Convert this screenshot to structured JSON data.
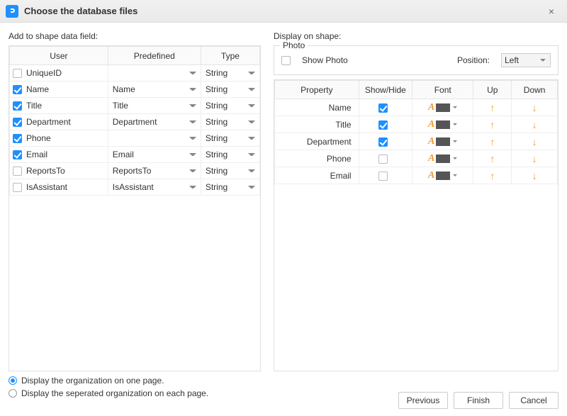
{
  "dialog": {
    "title": "Choose the database files",
    "close_glyph": "×"
  },
  "left": {
    "label": "Add to shape data field:",
    "headers": {
      "user": "User",
      "predefined": "Predefined",
      "type": "Type"
    },
    "rows": [
      {
        "checked": false,
        "user": "UniqueID",
        "predefined": "",
        "type": "String"
      },
      {
        "checked": true,
        "user": "Name",
        "predefined": "Name",
        "type": "String"
      },
      {
        "checked": true,
        "user": "Title",
        "predefined": "Title",
        "type": "String"
      },
      {
        "checked": true,
        "user": "Department",
        "predefined": "Department",
        "type": "String"
      },
      {
        "checked": true,
        "user": "Phone",
        "predefined": "",
        "type": "String"
      },
      {
        "checked": true,
        "user": "Email",
        "predefined": "Email",
        "type": "String"
      },
      {
        "checked": false,
        "user": "ReportsTo",
        "predefined": "ReportsTo",
        "type": "String"
      },
      {
        "checked": false,
        "user": "IsAssistant",
        "predefined": "IsAssistant",
        "type": "String"
      }
    ]
  },
  "right": {
    "label": "Display on shape:",
    "photo": {
      "legend": "Photo",
      "show_label": "Show Photo",
      "show_checked": false,
      "position_label": "Position:",
      "position_value": "Left"
    },
    "headers": {
      "property": "Property",
      "showhide": "Show/Hide",
      "font": "Font",
      "up": "Up",
      "down": "Down"
    },
    "rows": [
      {
        "property": "Name",
        "show": true
      },
      {
        "property": "Title",
        "show": true
      },
      {
        "property": "Department",
        "show": true
      },
      {
        "property": "Phone",
        "show": false
      },
      {
        "property": "Email",
        "show": false
      }
    ]
  },
  "options": {
    "one_page": {
      "label": "Display the organization on one page.",
      "checked": true
    },
    "separated": {
      "label": "Display the seperated organization on each page.",
      "checked": false
    }
  },
  "buttons": {
    "previous": "Previous",
    "finish": "Finish",
    "cancel": "Cancel"
  }
}
